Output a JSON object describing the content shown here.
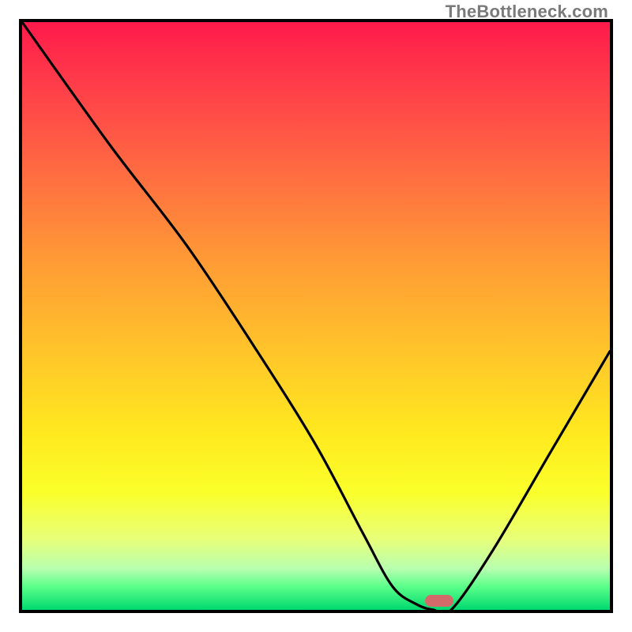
{
  "watermark": "TheBottleneck.com",
  "chart_data": {
    "type": "line",
    "title": "",
    "xlabel": "",
    "ylabel": "",
    "xlim": [
      0,
      100
    ],
    "ylim": [
      0,
      100
    ],
    "grid": false,
    "legend": false,
    "background": "red-yellow-green vertical gradient",
    "series": [
      {
        "name": "bottleneck-curve",
        "x": [
          0,
          15,
          28,
          40,
          50,
          58,
          63,
          67,
          70,
          73,
          80,
          90,
          100
        ],
        "y": [
          100,
          79,
          62,
          44,
          28,
          13,
          4,
          1,
          0,
          0,
          10,
          27,
          44
        ]
      }
    ],
    "annotations": [
      {
        "name": "optimal-marker",
        "shape": "pill",
        "x": 71,
        "y": 1,
        "color": "#d46a6a"
      }
    ]
  }
}
